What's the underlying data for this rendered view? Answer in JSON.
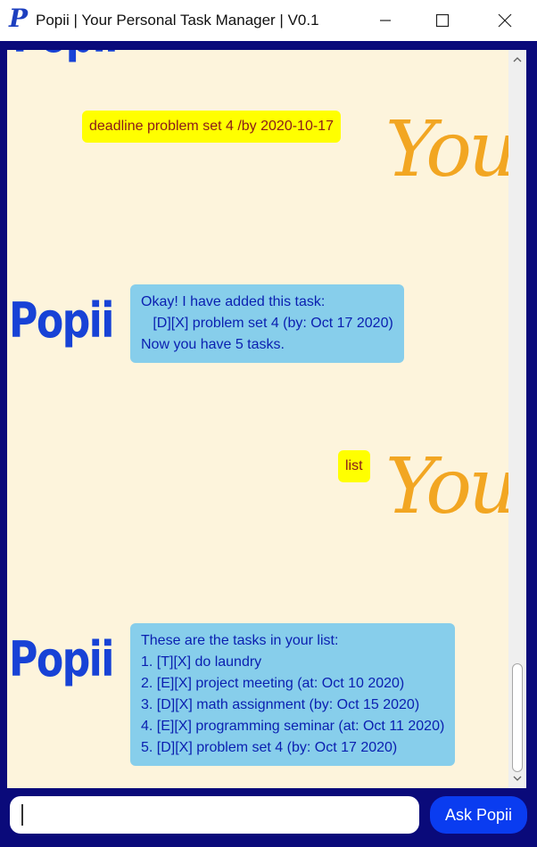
{
  "window": {
    "title": "Popii | Your Personal Task Manager | V0.1",
    "icon_letter": "P",
    "minimize_glyph": "—",
    "maximize_glyph": "☐",
    "close_glyph": "✕"
  },
  "avatars": {
    "user_name": "You",
    "bot_name": "Popii"
  },
  "messages": [
    {
      "sender": "user",
      "text": "deadline problem set 4 /by 2020-10-17"
    },
    {
      "sender": "bot",
      "text": "Okay! I have added this task:\n   [D][X] problem set 4 (by: Oct 17 2020)\nNow you have 5 tasks."
    },
    {
      "sender": "user",
      "text": "list"
    },
    {
      "sender": "bot",
      "text": "These are the tasks in your list:\n1. [T][X] do laundry\n2. [E][X] project meeting (at: Oct 10 2020)\n3. [D][X] math assignment (by: Oct 15 2020)\n4. [E][X] programming seminar (at: Oct 11 2020)\n5. [D][X] problem set 4 (by: Oct 17 2020)"
    }
  ],
  "input": {
    "value": "",
    "placeholder": ""
  },
  "ask_button": {
    "label": "Ask Popii"
  },
  "scroll": {
    "position_fraction": 0.95
  },
  "colors": {
    "frame": "#0a0a7a",
    "chat_background": "#fdf4dc",
    "user_bubble": "#ffff00",
    "bot_bubble": "#87ceeb",
    "user_avatar": "#f2a622",
    "bot_avatar": "#1742d6",
    "ask_button": "#0a3cf0"
  }
}
